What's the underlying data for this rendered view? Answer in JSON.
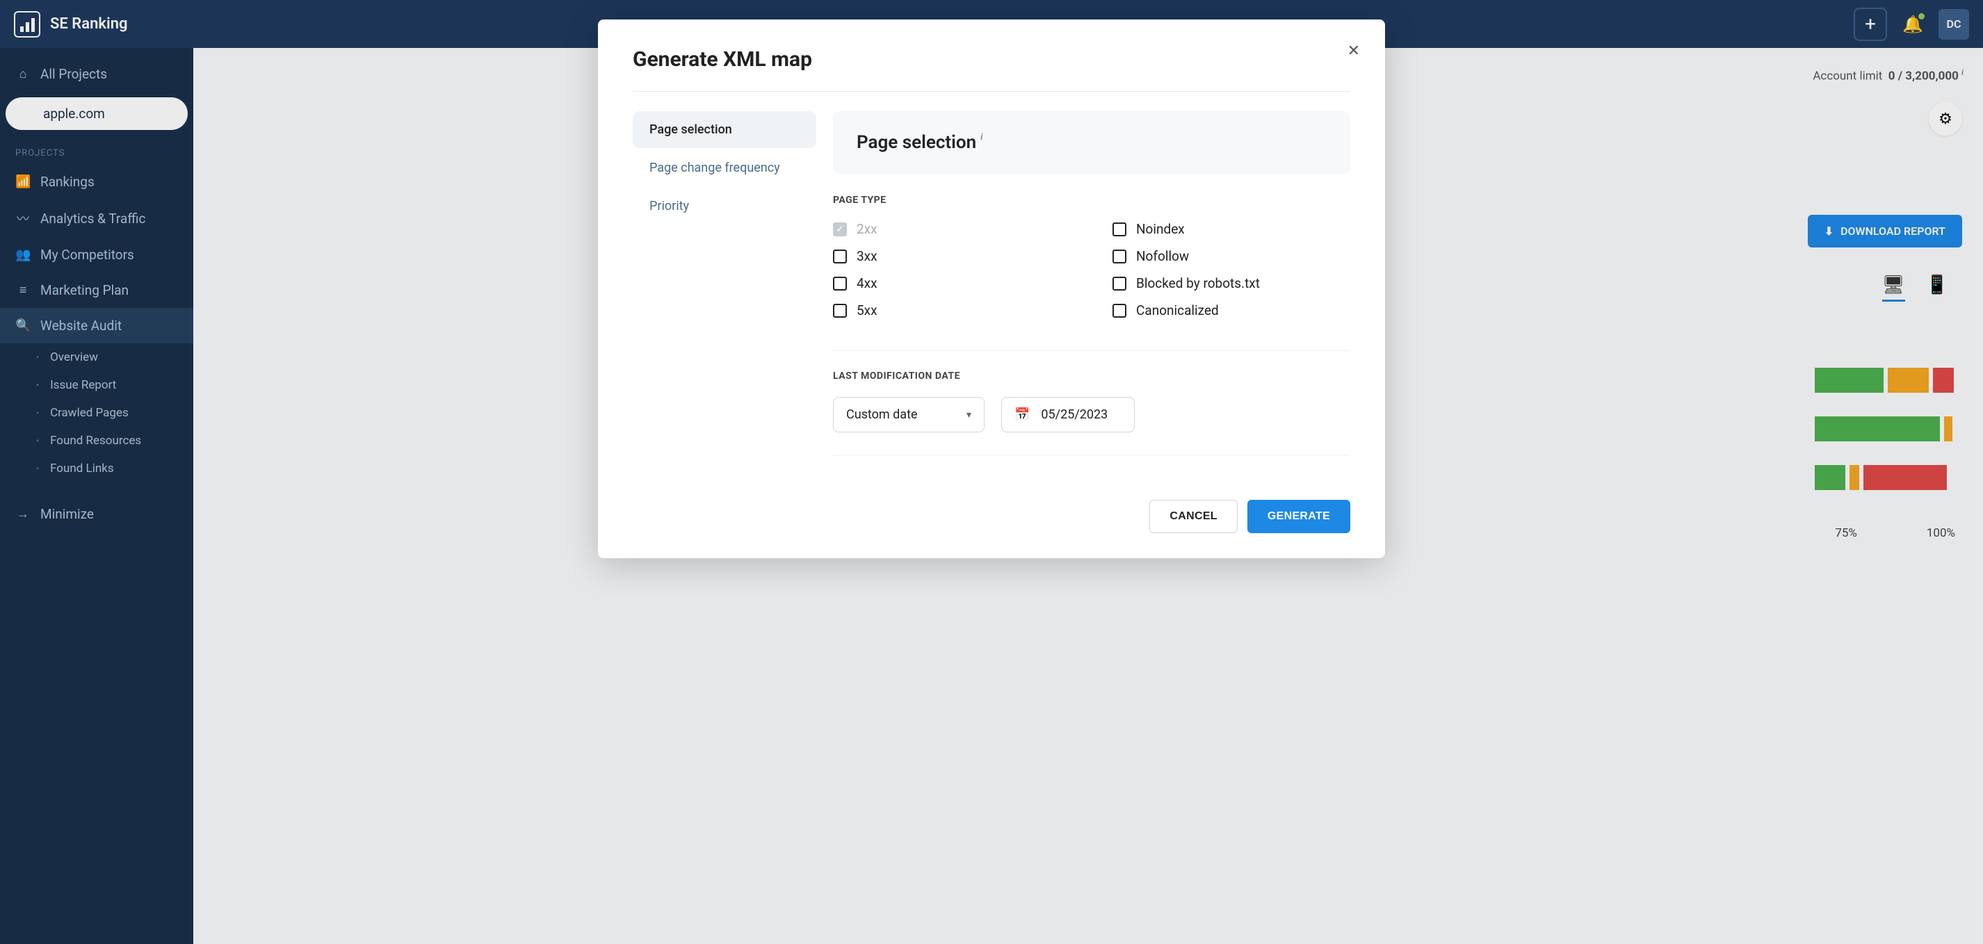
{
  "app": {
    "name": "SE Ranking"
  },
  "topbar": {
    "avatar_initials": "DC"
  },
  "sidebar": {
    "all_projects": "All Projects",
    "current_project": "apple.com",
    "section_label": "PROJECTS",
    "items": {
      "rankings": "Rankings",
      "analytics": "Analytics & Traffic",
      "competitors": "My Competitors",
      "marketing": "Marketing Plan",
      "audit": "Website Audit"
    },
    "audit_subitems": {
      "overview": "Overview",
      "issue_report": "Issue Report",
      "crawled_pages": "Crawled Pages",
      "found_resources": "Found Resources",
      "found_links": "Found Links"
    },
    "minimize": "Minimize"
  },
  "main": {
    "account_limit_label": "Account limit",
    "account_limit_value": "0 / 3,200,000",
    "download_report": "DOWNLOAD REPORT",
    "percent_75": "75%",
    "percent_100": "100%"
  },
  "modal": {
    "title": "Generate XML map",
    "nav": {
      "page_selection": "Page selection",
      "page_change_frequency": "Page change frequency",
      "priority": "Priority"
    },
    "content_title": "Page selection",
    "page_type_label": "PAGE TYPE",
    "checkboxes_left": {
      "c2xx": "2xx",
      "c3xx": "3xx",
      "c4xx": "4xx",
      "c5xx": "5xx"
    },
    "checkboxes_right": {
      "noindex": "Noindex",
      "nofollow": "Nofollow",
      "blocked": "Blocked by robots.txt",
      "canonicalized": "Canonicalized"
    },
    "last_mod_label": "LAST MODIFICATION DATE",
    "date_select": "Custom date",
    "date_value": "05/25/2023",
    "cancel": "CANCEL",
    "generate": "GENERATE"
  }
}
